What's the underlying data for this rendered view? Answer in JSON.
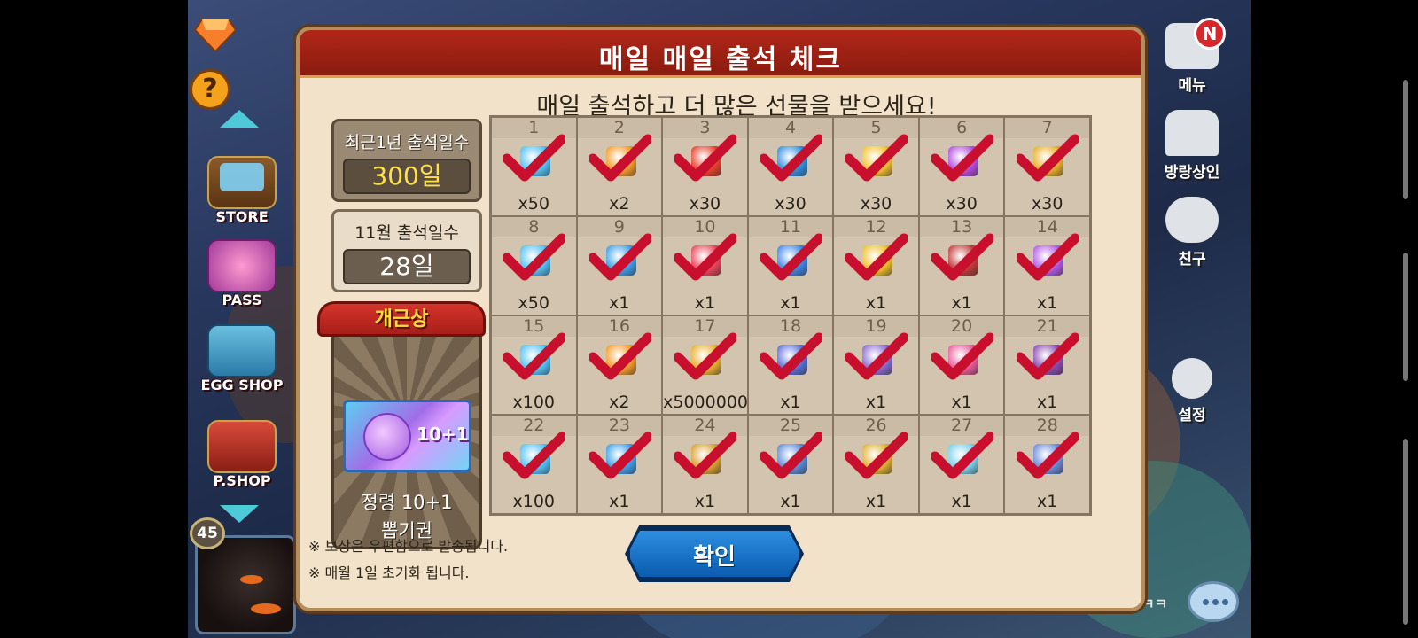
{
  "modal": {
    "title": "매일 매일 출석 체크",
    "subtitle": "매일 출석하고 더 많은 선물을 받으세요!",
    "stats": {
      "year_caption": "최근1년 출석일수",
      "year_value": "300일",
      "month_caption": "11월 출석일수",
      "month_value": "28일"
    },
    "perfect": {
      "ribbon": "개근상",
      "ticket_tag": "10+1",
      "caption_line1": "정령 10+1",
      "caption_line2": "뽑기권"
    },
    "notes": [
      "※ 보상은 우편함으로 발송됩니다.",
      "※ 매월 1일 초기화 됩니다."
    ],
    "confirm_label": "확인",
    "days": [
      {
        "day": "1",
        "qty": "x50",
        "item_icon": "diamond-icon",
        "color": "#4fc3f7",
        "checked": true
      },
      {
        "day": "2",
        "qty": "x2",
        "item_icon": "ticket-icon",
        "color": "#f39c2a",
        "checked": true
      },
      {
        "day": "3",
        "qty": "x30",
        "item_icon": "energy-burst-icon",
        "color": "#e8412c",
        "checked": true
      },
      {
        "day": "4",
        "qty": "x30",
        "item_icon": "energy-burst-icon",
        "color": "#2f8fe0",
        "checked": true
      },
      {
        "day": "5",
        "qty": "x30",
        "item_icon": "energy-burst-icon",
        "color": "#f2c230",
        "checked": true
      },
      {
        "day": "6",
        "qty": "x30",
        "item_icon": "energy-burst-icon",
        "color": "#b34de0",
        "checked": true
      },
      {
        "day": "7",
        "qty": "x30",
        "item_icon": "energy-burst-icon",
        "color": "#e8b02a",
        "checked": true
      },
      {
        "day": "8",
        "qty": "x50",
        "item_icon": "diamond-icon",
        "color": "#4fc3f7",
        "checked": true
      },
      {
        "day": "9",
        "qty": "x1",
        "item_icon": "ticket-icon",
        "color": "#3aa0e8",
        "checked": true
      },
      {
        "day": "10",
        "qty": "x1",
        "item_icon": "gem-shard-icon",
        "color": "#e8465a",
        "checked": true
      },
      {
        "day": "11",
        "qty": "x1",
        "item_icon": "gem-shard-icon",
        "color": "#3d86e8",
        "checked": true
      },
      {
        "day": "12",
        "qty": "x1",
        "item_icon": "gem-shard-icon",
        "color": "#f0c028",
        "checked": true
      },
      {
        "day": "13",
        "qty": "x1",
        "item_icon": "rainbow-gem-icon",
        "color": "#c23a3a",
        "checked": true
      },
      {
        "day": "14",
        "qty": "x1",
        "item_icon": "crystal-icon",
        "color": "#b25ce8",
        "checked": true
      },
      {
        "day": "15",
        "qty": "x100",
        "item_icon": "diamond-icon",
        "color": "#4fc3f7",
        "checked": true
      },
      {
        "day": "16",
        "qty": "x2",
        "item_icon": "ticket-icon",
        "color": "#f39c2a",
        "checked": true
      },
      {
        "day": "17",
        "qty": "x5000000",
        "item_icon": "gold-pile-icon",
        "color": "#e8b030",
        "checked": true
      },
      {
        "day": "18",
        "qty": "x1",
        "item_icon": "wand-icon",
        "color": "#5a6fd8",
        "checked": true
      },
      {
        "day": "19",
        "qty": "x1",
        "item_icon": "wand-icon",
        "color": "#8a6ad0",
        "checked": true
      },
      {
        "day": "20",
        "qty": "x1",
        "item_icon": "winged-relic-icon",
        "color": "#e85a9a",
        "checked": true
      },
      {
        "day": "21",
        "qty": "x1",
        "item_icon": "egg-icon",
        "color": "#8a4ab0",
        "checked": true
      },
      {
        "day": "22",
        "qty": "x100",
        "item_icon": "diamond-icon",
        "color": "#4fc3f7",
        "checked": true
      },
      {
        "day": "23",
        "qty": "x1",
        "item_icon": "ticket-icon",
        "color": "#3aa0e8",
        "checked": true
      },
      {
        "day": "24",
        "qty": "x1",
        "item_icon": "potion-icon",
        "color": "#d8a030",
        "checked": true
      },
      {
        "day": "25",
        "qty": "x1",
        "item_icon": "potion-icon",
        "color": "#5a8ad8",
        "checked": true
      },
      {
        "day": "26",
        "qty": "x1",
        "item_icon": "potion-icon",
        "color": "#e0b030",
        "checked": true
      },
      {
        "day": "27",
        "qty": "x1",
        "item_icon": "teapot-icon",
        "color": "#7ad0e8",
        "checked": true
      },
      {
        "day": "28",
        "qty": "x1",
        "item_icon": "ticket-icon",
        "color": "#6a8ad8",
        "checked": true
      }
    ]
  },
  "left_menu": {
    "store": "STORE",
    "pass": "PASS",
    "egg_shop": "EGG SHOP",
    "p_shop": "P.SHOP",
    "level": "45"
  },
  "right_menu": {
    "menu": "메뉴",
    "menu_badge": "N",
    "merchant": "방랑상인",
    "friends": "친구",
    "settings": "설정",
    "chat_preview": "ㅋㅋ"
  },
  "colors": {
    "header_red": "#a52215",
    "panel_beige": "#f1e2c9",
    "check_red": "#c8102e",
    "confirm_blue": "#1a6fc8",
    "gold_text": "#ffe04a"
  }
}
